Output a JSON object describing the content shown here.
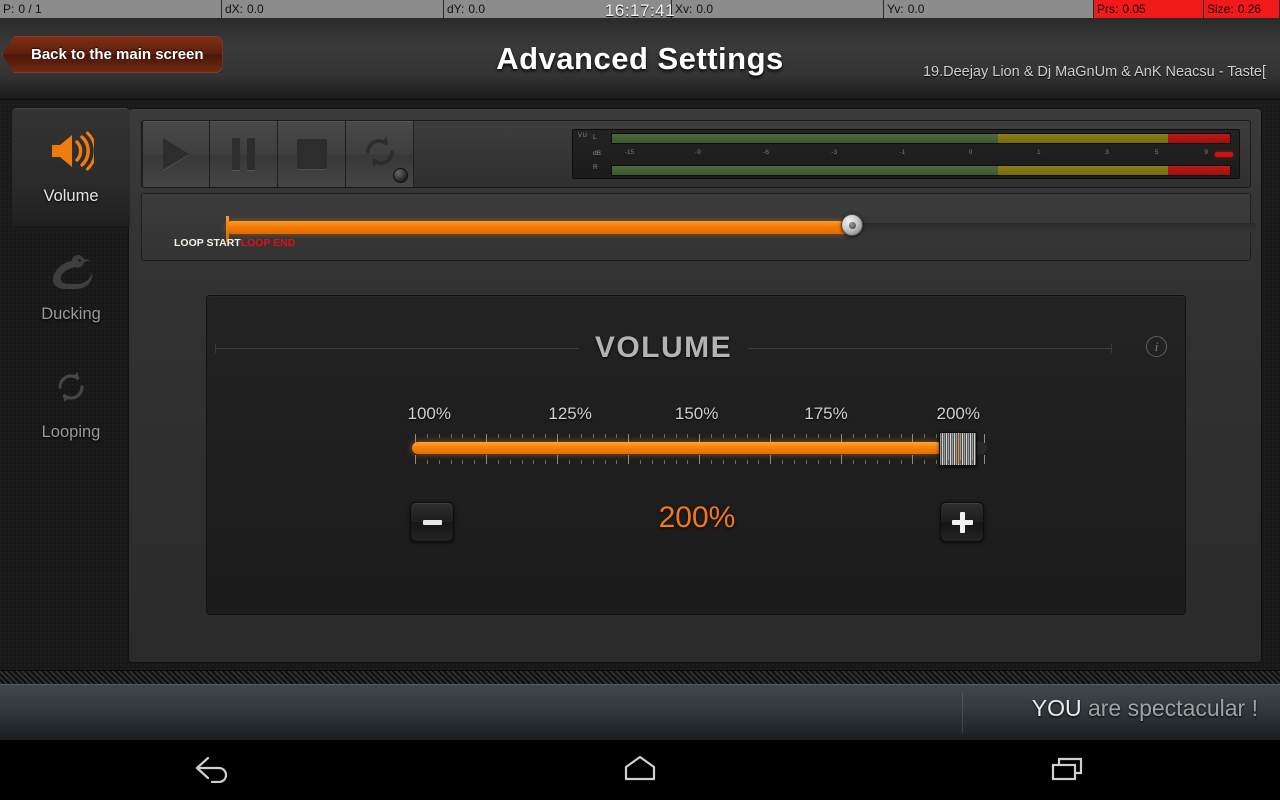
{
  "statusbar": {
    "items": [
      {
        "label": "P:",
        "value": "0 / 1",
        "highlight": false
      },
      {
        "label": "dX:",
        "value": "0.0",
        "highlight": false
      },
      {
        "label": "dY:",
        "value": "0.0",
        "highlight": false
      },
      {
        "label": "Xv:",
        "value": "0.0",
        "highlight": false
      },
      {
        "label": "Yv:",
        "value": "0.0",
        "highlight": false
      },
      {
        "label": "Prs:",
        "value": "0.05",
        "highlight": true
      },
      {
        "label": "Size:",
        "value": "0.26",
        "highlight": true
      }
    ],
    "clock": "16:17:41"
  },
  "header": {
    "back_label": "Back to the main screen",
    "title": "Advanced Settings",
    "track": "19.Deejay Lion & Dj MaGnUm & AnK Neacsu  - Taste["
  },
  "sidebar": {
    "items": [
      {
        "label": "Volume",
        "icon": "speaker-icon",
        "active": true
      },
      {
        "label": "Ducking",
        "icon": "duck-icon",
        "active": false
      },
      {
        "label": "Looping",
        "icon": "loop-icon",
        "active": false
      }
    ]
  },
  "transport": {
    "buttons": [
      {
        "name": "play",
        "label": "Play"
      },
      {
        "name": "pause",
        "label": "Pause"
      },
      {
        "name": "stop",
        "label": "Stop"
      },
      {
        "name": "repeat",
        "label": "Repeat"
      }
    ]
  },
  "vu_meter": {
    "tag": "VU",
    "left_label": "L",
    "right_label": "R",
    "unit_label": "dB",
    "scale": [
      "-15",
      "-9",
      "-6",
      "-3",
      "-1",
      "0",
      "1",
      "3",
      "5",
      "9"
    ],
    "zones": {
      "green_pct": 62.5,
      "yellow_pct": 27.5,
      "red_pct": 10
    },
    "clip_color": "#cc1414"
  },
  "seekbar": {
    "loop_start_label": "LOOP START",
    "loop_end_label": "LOOP END",
    "position_pct": 60.5
  },
  "volume_panel": {
    "title": "VOLUME",
    "info_glyph": "i",
    "value_text": "200%",
    "minus_label": "−",
    "plus_label": "+",
    "accent_color": "#f2761a",
    "slider": {
      "tick_labels": [
        "100%",
        "125%",
        "150%",
        "175%",
        "200%"
      ],
      "min": 100,
      "max": 200,
      "current": 200,
      "fill_pct": 92
    }
  },
  "footer": {
    "message_strong": "YOU",
    "message_rest": " are spectacular !"
  },
  "navbar": {
    "buttons": [
      {
        "name": "back",
        "label": "Back"
      },
      {
        "name": "home",
        "label": "Home"
      },
      {
        "name": "recents",
        "label": "Recent apps"
      }
    ]
  }
}
